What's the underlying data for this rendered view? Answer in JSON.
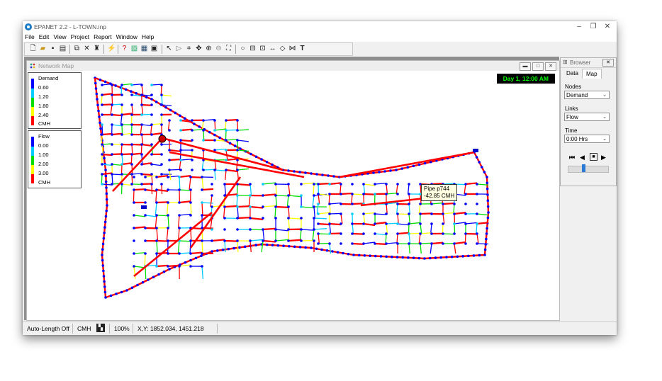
{
  "window": {
    "title": "EPANET 2.2 - L-TOWN.inp"
  },
  "menu": [
    "File",
    "Edit",
    "View",
    "Project",
    "Report",
    "Window",
    "Help"
  ],
  "toolbar": {
    "icons": [
      "new-icon",
      "open-icon",
      "save-icon",
      "print-icon",
      "copy-icon",
      "delete-icon",
      "find-icon",
      "run-icon",
      "query-icon",
      "graph-icon",
      "table-icon",
      "options-icon",
      "select-object-icon",
      "select-vertex-icon",
      "select-region-icon",
      "pan-icon",
      "zoom-in-icon",
      "zoom-out-icon",
      "full-extent-icon",
      "add-junction-icon",
      "add-reservoir-icon",
      "add-tank-icon",
      "add-pipe-icon",
      "add-pump-icon",
      "add-valve-icon",
      "add-label-icon"
    ],
    "text_tool_glyph": "T"
  },
  "map_window": {
    "title": "Network Map",
    "day_time": "Day 1, 12:00 AM",
    "tooltip": {
      "line1": "Pipe p744",
      "line2": "-42.85 CMH"
    }
  },
  "legend_demand": {
    "title": "Demand",
    "values": [
      "0.60",
      "1.20",
      "1.80",
      "2.40"
    ],
    "unit": "CMH",
    "colors": [
      "#0000ff",
      "#00ccff",
      "#00dd00",
      "#ffff00",
      "#ff0000"
    ]
  },
  "legend_flow": {
    "title": "Flow",
    "values": [
      "0.00",
      "1.00",
      "2.00",
      "3.00"
    ],
    "unit": "CMH",
    "colors": [
      "#0000ff",
      "#00ccff",
      "#00dd00",
      "#ffff00",
      "#ff0000"
    ]
  },
  "browser": {
    "title": "Browser",
    "tabs": [
      "Data",
      "Map"
    ],
    "active_tab": "Map",
    "nodes_label": "Nodes",
    "nodes_value": "Demand",
    "links_label": "Links",
    "links_value": "Flow",
    "time_label": "Time",
    "time_value": "0:00 Hrs"
  },
  "status": {
    "auto_length": "Auto-Length Off",
    "units": "CMH",
    "zoom": "100%",
    "xy": "X,Y: 1852.034, 1451.218"
  }
}
